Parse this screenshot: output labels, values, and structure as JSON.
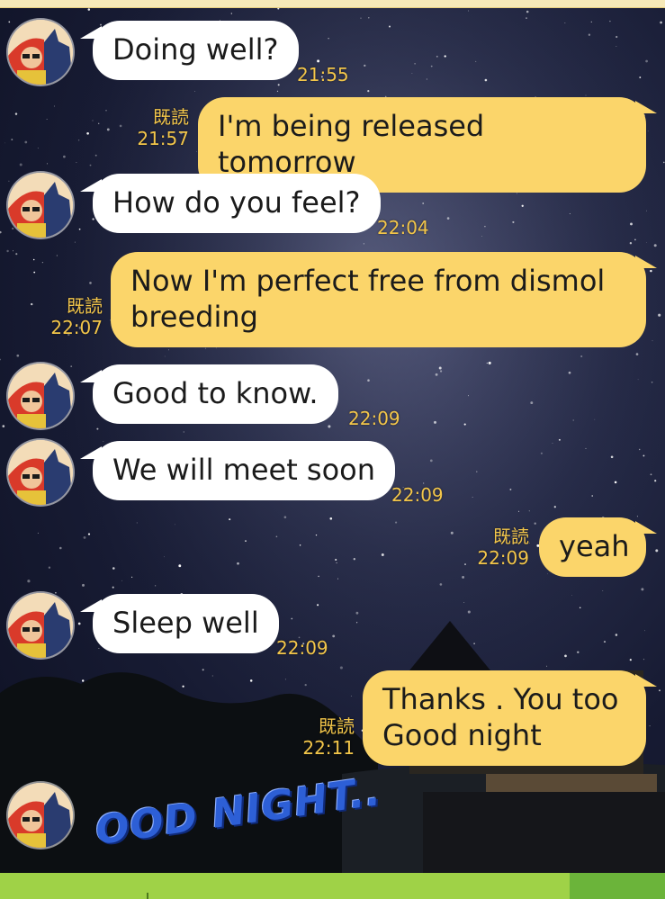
{
  "messages": [
    {
      "side": "in",
      "text": "Doing well?",
      "time": "21:55"
    },
    {
      "side": "out",
      "text": "I'm being released tomorrow",
      "read": "既読",
      "time": "21:57"
    },
    {
      "side": "in",
      "text": "How do you feel?",
      "time": "22:04"
    },
    {
      "side": "out",
      "lines": [
        "Now I'm perfect free from dismol",
        "breeding"
      ],
      "read": "既読",
      "time": "22:07"
    },
    {
      "side": "in",
      "text": "Good to know.",
      "time": "22:09"
    },
    {
      "side": "in",
      "text": "We will meet soon",
      "time": "22:09"
    },
    {
      "side": "out",
      "text": "yeah",
      "read": "既読",
      "time": "22:09"
    },
    {
      "side": "in",
      "text": "Sleep well",
      "time": "22:09"
    },
    {
      "side": "out",
      "lines": [
        "Thanks . You too",
        "Good night"
      ],
      "read": "既読",
      "time": "22:11"
    }
  ],
  "sticker": {
    "text": "OOD NIGHT.."
  },
  "colors": {
    "incoming_bubble": "#ffffff",
    "outgoing_bubble": "#fbd56a",
    "timestamp": "#f3c64a",
    "bottom_bar": "#9fd247"
  },
  "icons": {
    "avatar": "contact-avatar-icon"
  }
}
